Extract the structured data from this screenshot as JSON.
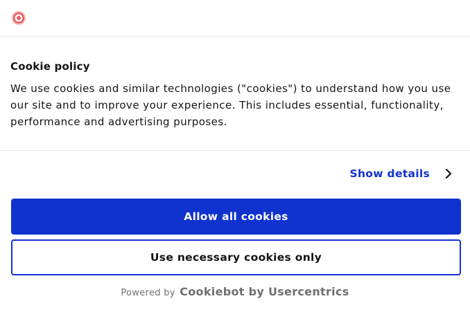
{
  "brand": {
    "logo_icon": "target-logo-icon",
    "logo_color": "#ec5b5b"
  },
  "dialog": {
    "title": "Cookie policy",
    "body": "We use cookies and similar technologies (\"cookies\") to understand how you use our site and to improve your experience. This includes essential, functionality, performance and advertising purposes."
  },
  "details": {
    "label": "Show details",
    "icon": "chevron-right-icon"
  },
  "actions": {
    "allow_all_label": "Allow all cookies",
    "necessary_only_label": "Use necessary cookies only"
  },
  "footer": {
    "powered_by": "Powered by",
    "provider": "Cookiebot by Usercentrics"
  },
  "colors": {
    "accent": "#1032cf",
    "text": "#141414",
    "muted": "#6f6f6f",
    "divider": "#e6e6e6"
  }
}
